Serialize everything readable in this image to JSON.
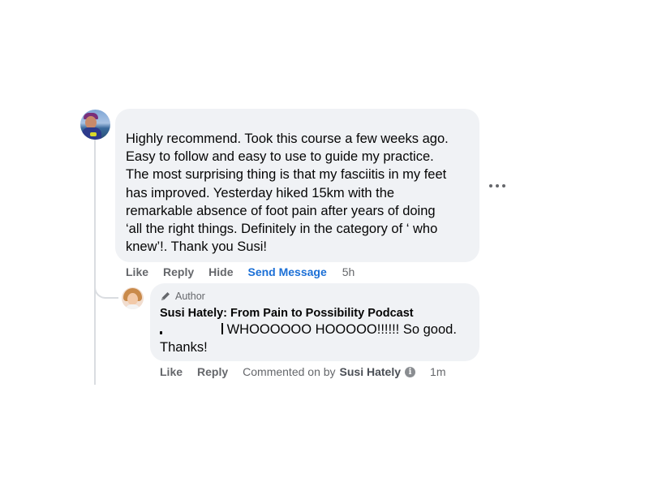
{
  "comment": {
    "text": "Highly recommend. Took this course a few weeks ago.\nEasy to follow and easy to use to guide my practice.\nThe most surprising thing is that my fasciitis in my feet\nhas improved. Yesterday hiked 15km with the\nremarkable absence of foot pain after years of doing\n‘all the right things. Definitely in the category of ‘ who\nknew’!. Thank you Susi!",
    "actions": {
      "like": "Like",
      "reply": "Reply",
      "hide": "Hide",
      "send_message": "Send Message",
      "time": "5h"
    },
    "more_icon": "more-horizontal-icon"
  },
  "reply": {
    "badge": "Author",
    "badge_icon": "pencil-icon",
    "author_name": "Susi Hately: From Pain to Possibility Podcast",
    "text_after_mention": "WHOOOOOO HOOOOO!!!!!! So good.",
    "text_line2": "Thanks!",
    "actions": {
      "like": "Like",
      "reply": "Reply",
      "commented_on_by": "Commented on by",
      "by_name": "Susi Hately",
      "time": "1m"
    },
    "info_icon": "info-icon"
  },
  "colors": {
    "bubble": "#f0f2f5",
    "meta_text": "#65676b",
    "link_blue": "#1b6fd6",
    "text": "#050505"
  }
}
